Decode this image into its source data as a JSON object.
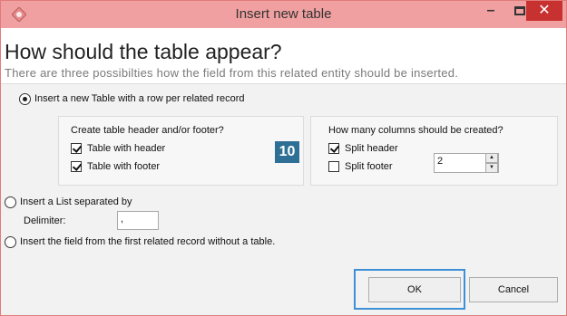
{
  "window": {
    "title": "Insert new table",
    "controls": {
      "minimize": "–",
      "close": "✕"
    }
  },
  "header": {
    "heading": "How should the table appear?",
    "subheading": "There are three possibilties how the field from this  related entity should be inserted."
  },
  "options": {
    "table": {
      "label": "Insert a new Table with a row per related record",
      "selected": true
    },
    "list": {
      "label": "Insert a List separated by",
      "selected": false
    },
    "field": {
      "label": "Insert the field from the first related record without a table.",
      "selected": false
    }
  },
  "header_footer_panel": {
    "title": "Create table header and/or footer?",
    "with_header": {
      "label": "Table with header",
      "checked": true
    },
    "with_footer": {
      "label": "Table with footer",
      "checked": true
    }
  },
  "badge": "10",
  "columns_panel": {
    "title": "How many columns should be created?",
    "split_header": {
      "label": "Split header",
      "checked": true
    },
    "split_footer": {
      "label": "Split footer",
      "checked": false
    },
    "column_count": "2"
  },
  "delimiter": {
    "label": "Delimiter:",
    "value": ","
  },
  "buttons": {
    "ok": "OK",
    "cancel": "Cancel"
  },
  "colors": {
    "titlebar": "#f0a0a0",
    "close": "#c7312f",
    "badge": "#2e6f95",
    "focus": "#3d8fd6"
  }
}
